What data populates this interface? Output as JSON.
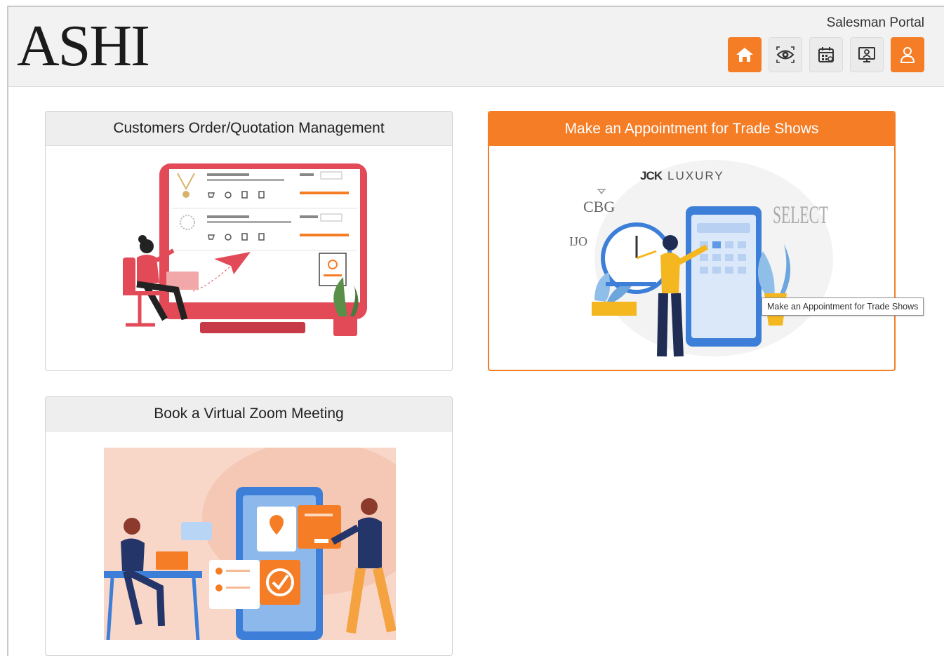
{
  "header": {
    "logo": "ASHI",
    "portal_title": "Salesman Portal",
    "nav": [
      {
        "icon": "home-icon",
        "active": true
      },
      {
        "icon": "eye-target-icon",
        "active": false
      },
      {
        "icon": "calendar-icon",
        "active": false
      },
      {
        "icon": "presentation-icon",
        "active": false
      },
      {
        "icon": "user-icon",
        "active": true
      }
    ]
  },
  "cards": {
    "orders": {
      "title": "Customers Order/Quotation Management"
    },
    "appointments": {
      "title": "Make an Appointment for Trade Shows",
      "brands": [
        "JCK LUXURY",
        "CBG",
        "SELECT",
        "IJO"
      ]
    },
    "zoom": {
      "title": "Book a Virtual Zoom Meeting"
    }
  },
  "tooltip": "Make an Appointment for Trade Shows",
  "colors": {
    "accent": "#f47d26",
    "red": "#e24a57",
    "blue": "#3d7fd8"
  }
}
